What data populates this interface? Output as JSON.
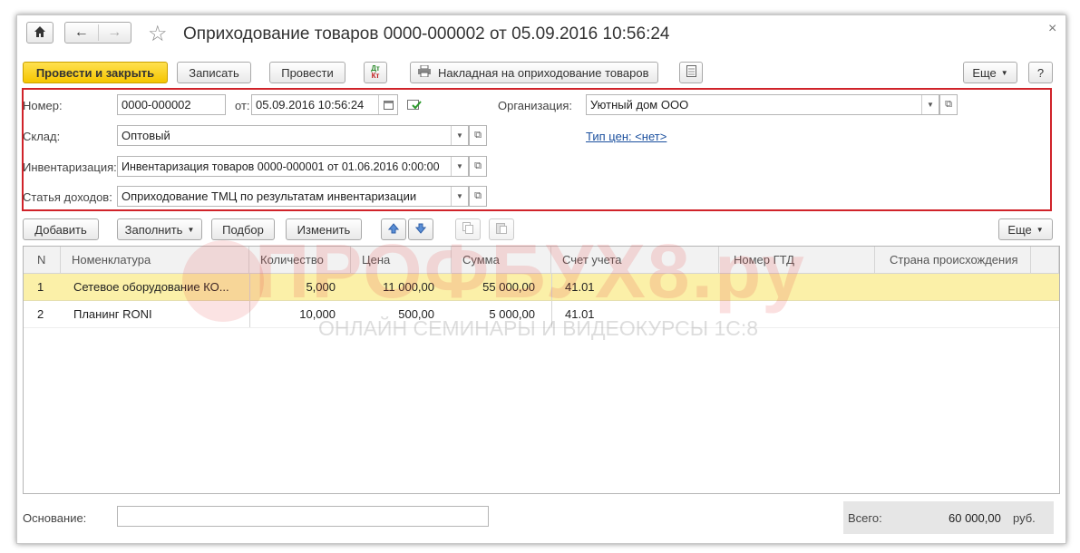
{
  "window": {
    "title": "Оприходование товаров 0000-000002 от 05.09.2016 10:56:24",
    "close_glyph": "×"
  },
  "toolbar": {
    "post_and_close": "Провести и закрыть",
    "save": "Записать",
    "post": "Провести",
    "dtkt_top": "Дт",
    "dtkt_bottom": "Кт",
    "print_label": "Накладная на оприходование товаров",
    "more": "Еще",
    "help": "?"
  },
  "header_fields": {
    "number_label": "Номер:",
    "number_value": "0000-000002",
    "date_label": "от:",
    "date_value": "05.09.2016 10:56:24",
    "org_label": "Организация:",
    "org_value": "Уютный дом ООО",
    "warehouse_label": "Склад:",
    "warehouse_value": "Оптовый",
    "price_type_link": "Тип цен: <нет>",
    "inventory_label": "Инвентаризация:",
    "inventory_value": "Инвентаризация товаров 0000-000001 от 01.06.2016 0:00:00",
    "income_label": "Статья доходов:",
    "income_value": "Оприходование ТМЦ по результатам инвентаризации"
  },
  "table_toolbar": {
    "add": "Добавить",
    "fill": "Заполнить",
    "pick": "Подбор",
    "edit": "Изменить",
    "more": "Еще"
  },
  "table": {
    "columns": [
      "N",
      "Номенклатура",
      "Количество",
      "Цена",
      "Сумма",
      "Счет учета",
      "Номер ГТД",
      "Страна происхождения"
    ],
    "rows": [
      {
        "n": "1",
        "item": "Сетевое оборудование КО...",
        "qty": "5,000",
        "price": "11 000,00",
        "sum": "55 000,00",
        "account": "41.01",
        "gtd": "",
        "country": ""
      },
      {
        "n": "2",
        "item": "Планинг RONI",
        "qty": "10,000",
        "price": "500,00",
        "sum": "5 000,00",
        "account": "41.01",
        "gtd": "",
        "country": ""
      }
    ]
  },
  "watermark": {
    "title": "ПРОФБУХ8.ру",
    "subtitle": "ОНЛАЙН СЕМИНАРЫ И ВИДЕОКУРСЫ 1С:8"
  },
  "footer": {
    "basis_label": "Основание:",
    "basis_value": "",
    "total_label": "Всего:",
    "total_value": "60 000,00",
    "currency": "руб."
  },
  "colors": {
    "primary_button": "#f5c500",
    "highlight_box": "#d0232a",
    "selected_row": "#fbf0a8",
    "link": "#1a4f9e"
  }
}
